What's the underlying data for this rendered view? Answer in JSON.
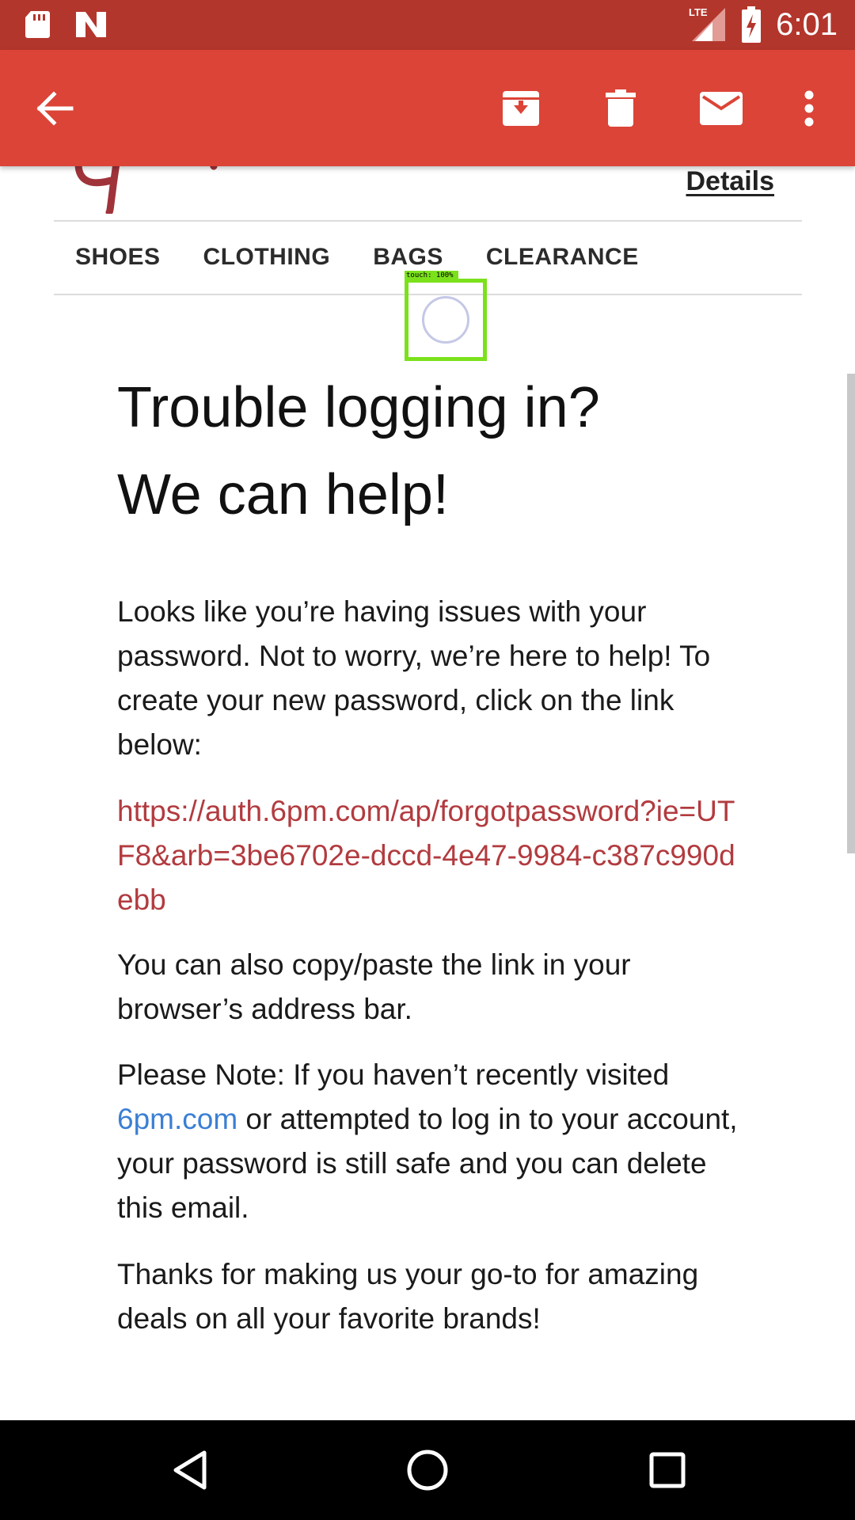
{
  "status_bar": {
    "network": "LTE",
    "time": "6:01"
  },
  "app_bar": {
    "icons": [
      "back-arrow-icon",
      "archive-icon",
      "delete-icon",
      "mark-unread-icon",
      "more-vert-icon"
    ]
  },
  "email": {
    "details_link": "Details",
    "nav_items": [
      "SHOES",
      "CLOTHING",
      "BAGS",
      "CLEARANCE"
    ],
    "headline_line1": "Trouble logging in?",
    "headline_line2": "We can help!",
    "para1": "Looks like you’re having issues with your password. Not to worry, we’re here to help! To create your new password, click on the link below:",
    "reset_url": "https://auth.6pm.com/ap/forgotpassword?ie=UTF8&arb=3be6702e-dccd-4e47-9984-c387c990debb",
    "para2": "You can also copy/paste the link in your browser’s address bar.",
    "para3_before": "Please Note: If you haven’t recently visited ",
    "para3_link": "6pm.com",
    "para3_after": " or attempted to log in to your account, your password is still safe and you can delete this email.",
    "para4": "Thanks for making us your go-to for amazing deals on all your favorite brands!"
  },
  "touch_overlay": {
    "label": "touch: 100%"
  },
  "colors": {
    "status_bar": "#b3362c",
    "app_bar": "#db4437",
    "link_red": "#b23b3f",
    "link_blue": "#3b7fd4",
    "touch_green": "#7be11b"
  },
  "nav_bar": {
    "icons": [
      "back-triangle-icon",
      "home-circle-icon",
      "recents-square-icon"
    ]
  }
}
